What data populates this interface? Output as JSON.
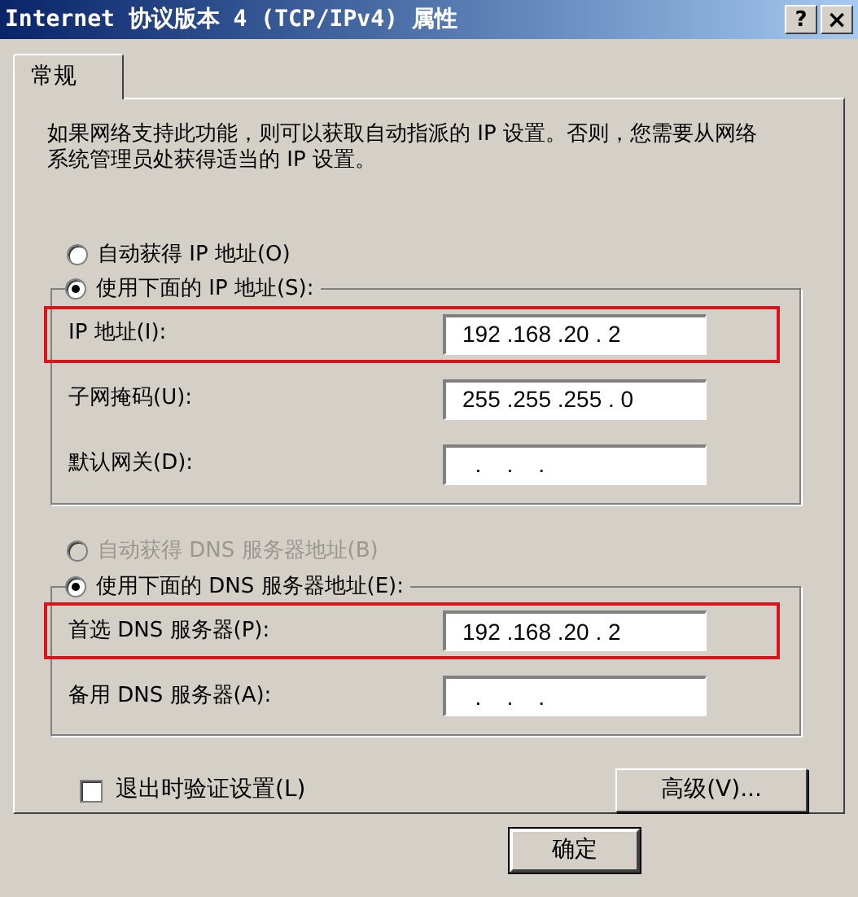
{
  "window": {
    "title": "Internet 协议版本 4 (TCP/IPv4) 属性",
    "help_button": "?",
    "close_button": "×"
  },
  "tabs": [
    {
      "label": "常规",
      "selected": true
    }
  ],
  "description": "如果网络支持此功能，则可以获取自动指派的 IP 设置。否则，您需要从网络系统管理员处获得适当的 IP 设置。",
  "ip_mode": [
    {
      "label": "自动获得 IP 地址(O)",
      "selected": false,
      "disabled": false
    },
    {
      "label": "使用下面的 IP 地址(S):",
      "selected": true,
      "disabled": false
    }
  ],
  "ip_fields": [
    {
      "label": "IP 地址(I):",
      "value": "192 .168 .20 . 2",
      "highlighted": true
    },
    {
      "label": "子网掩码(U):",
      "value": "255 .255 .255 . 0",
      "highlighted": false
    },
    {
      "label": "默认网关(D):",
      "value": "  .    .    .",
      "highlighted": false
    }
  ],
  "dns_mode": [
    {
      "label": "自动获得 DNS 服务器地址(B)",
      "selected": false,
      "disabled": true
    },
    {
      "label": "使用下面的 DNS 服务器地址(E):",
      "selected": true,
      "disabled": false
    }
  ],
  "dns_fields": [
    {
      "label": "首选 DNS 服务器(P):",
      "value": "192 .168 .20 . 2",
      "highlighted": true
    },
    {
      "label": "备用 DNS 服务器(A):",
      "value": "  .    .    .",
      "highlighted": false
    }
  ],
  "validate_checkbox": {
    "label": "退出时验证设置(L)",
    "checked": false
  },
  "advanced_button": "高级(V)...",
  "ok_button": "确定"
}
